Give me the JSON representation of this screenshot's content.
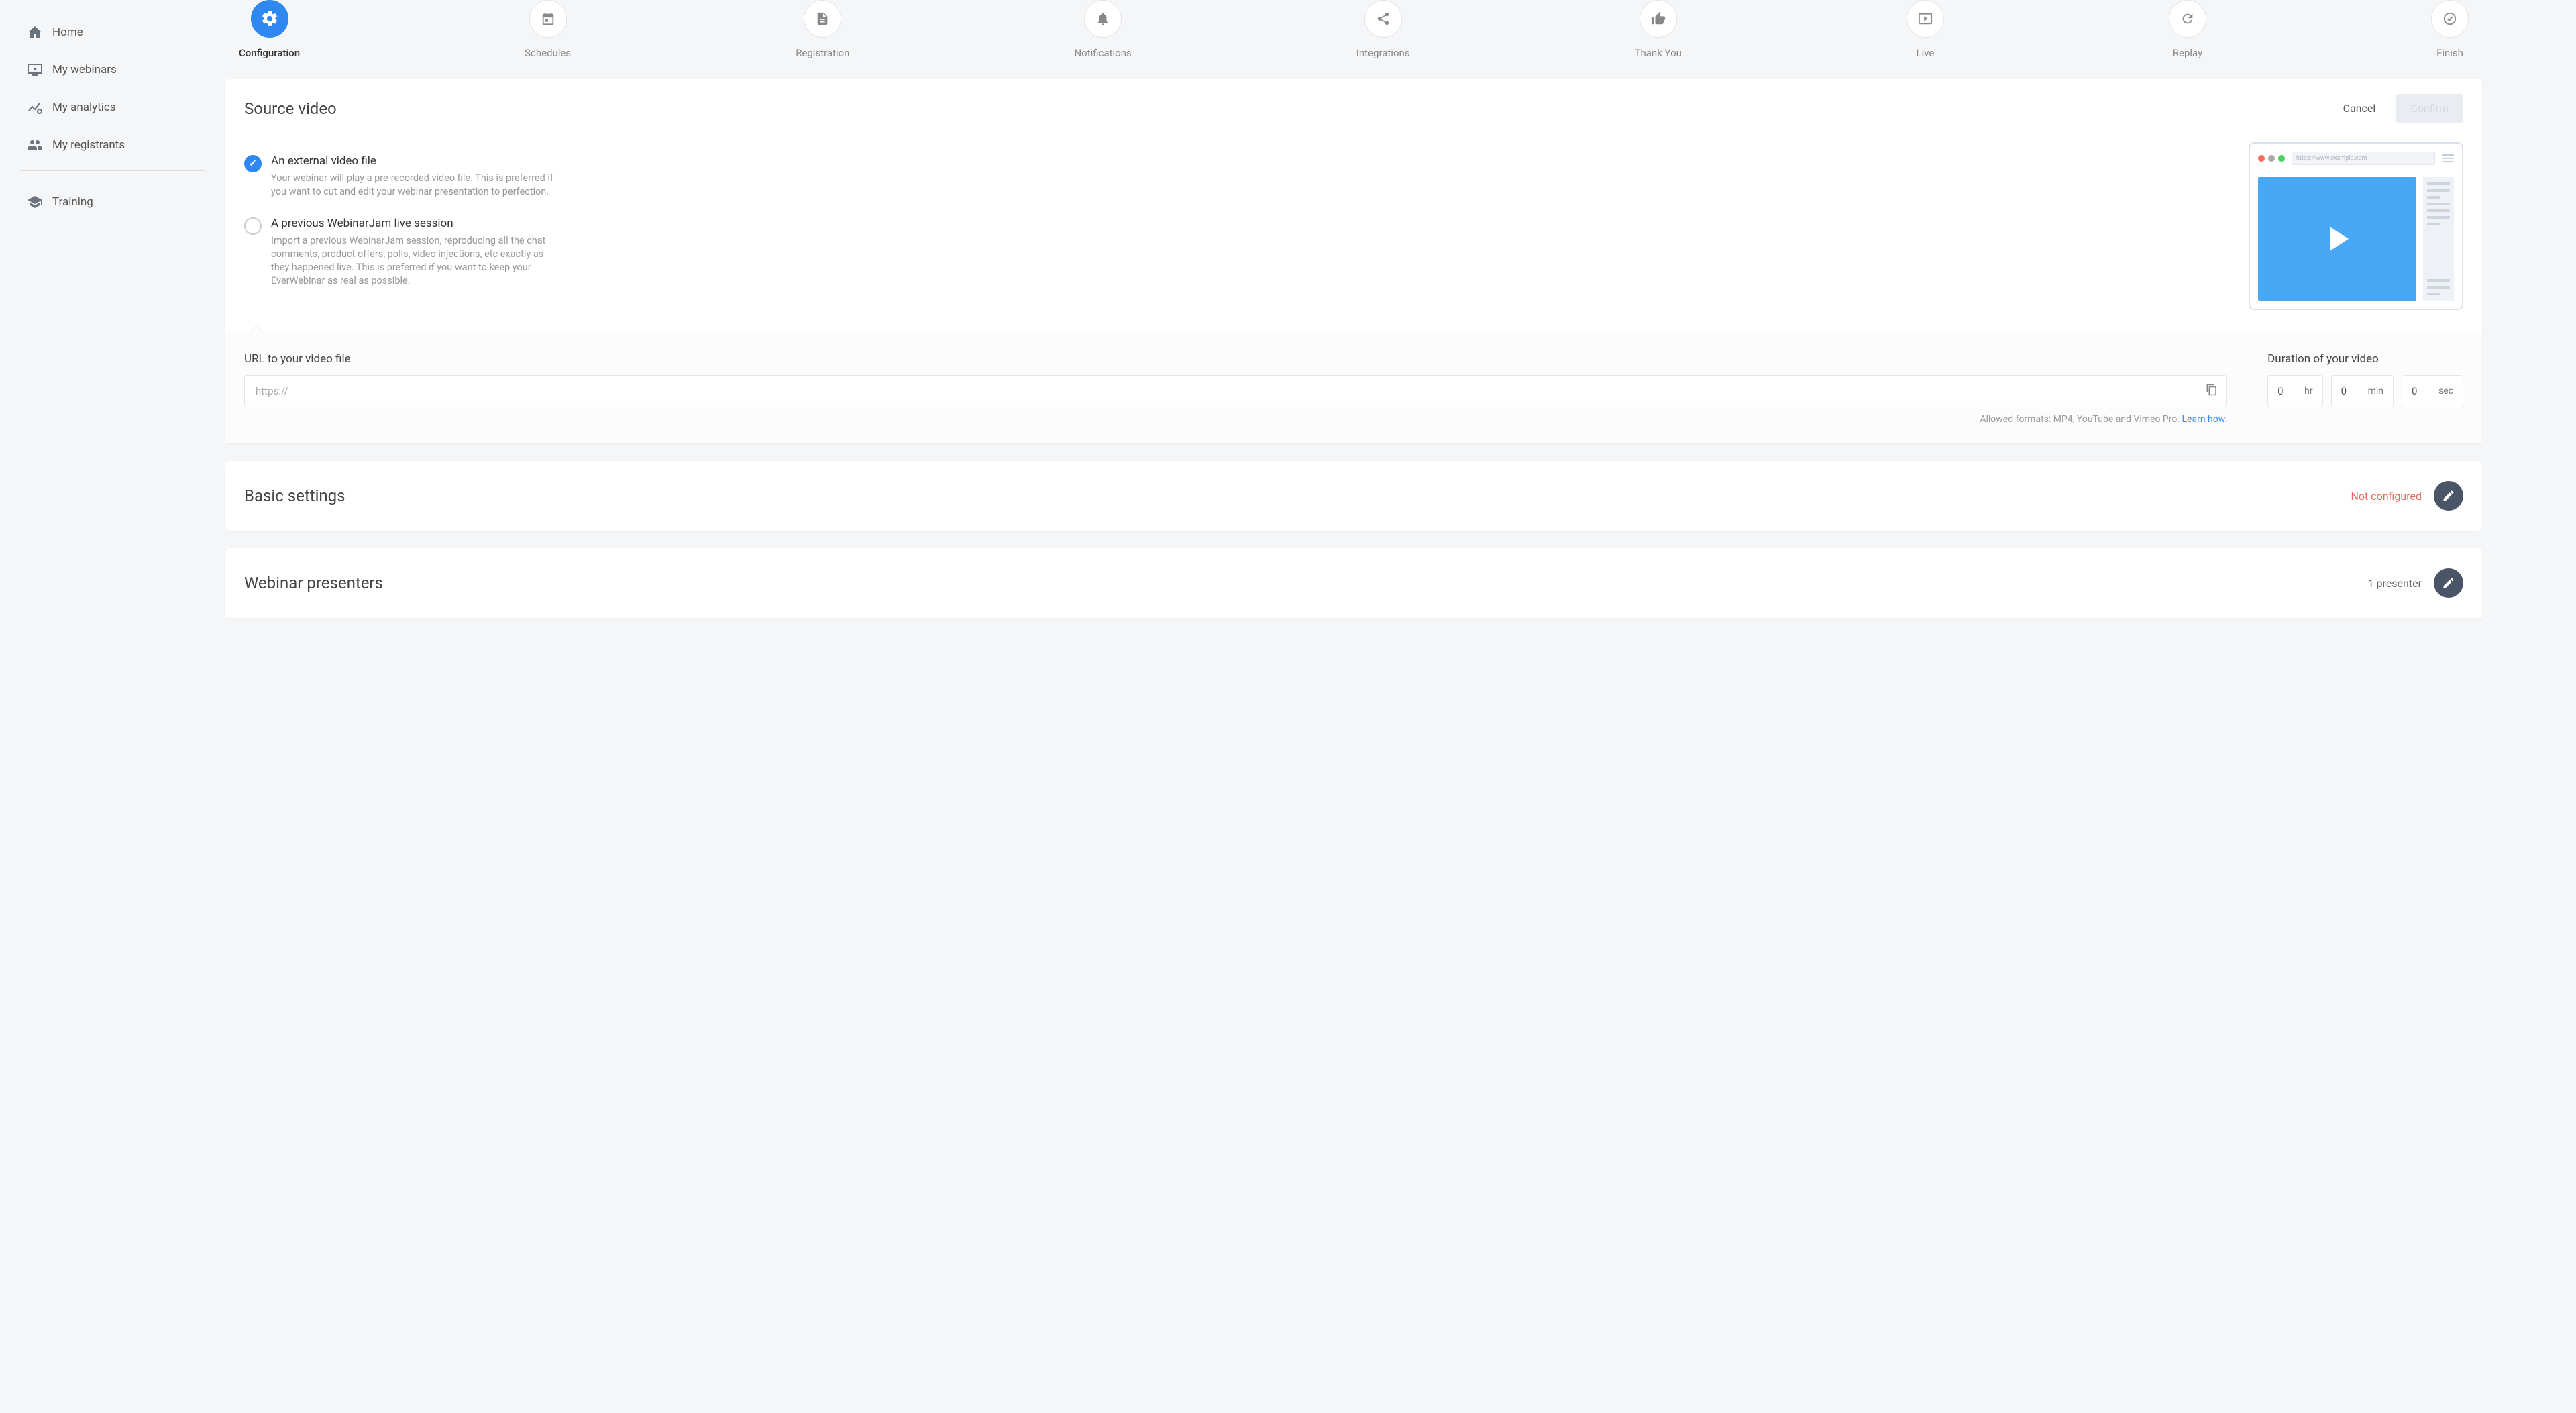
{
  "sidebar": {
    "items": [
      {
        "label": "Home",
        "icon": "home"
      },
      {
        "label": "My webinars",
        "icon": "monitor"
      },
      {
        "label": "My analytics",
        "icon": "chart"
      },
      {
        "label": "My registrants",
        "icon": "people"
      },
      {
        "label": "Training",
        "icon": "grad"
      }
    ]
  },
  "steps": [
    {
      "label": "Configuration",
      "icon": "gear",
      "active": true
    },
    {
      "label": "Schedules",
      "icon": "calday"
    },
    {
      "label": "Registration",
      "icon": "doc"
    },
    {
      "label": "Notifications",
      "icon": "bell"
    },
    {
      "label": "Integrations",
      "icon": "share"
    },
    {
      "label": "Thank You",
      "icon": "thumb"
    },
    {
      "label": "Live",
      "icon": "play"
    },
    {
      "label": "Replay",
      "icon": "refresh"
    },
    {
      "label": "Finish",
      "icon": "check"
    }
  ],
  "source_video": {
    "title": "Source video",
    "cancel": "Cancel",
    "confirm": "Confirm",
    "options": [
      {
        "title": "An external video file",
        "desc": "Your webinar will play a pre-recorded video file. This is preferred if you want to cut and edit your webinar presentation to perfection.",
        "selected": true
      },
      {
        "title": "A previous WebinarJam live session",
        "desc": "Import a previous WebinarJam session, reproducing all the chat comments, product offers, polls, video injections, etc exactly as they happened live. This is preferred if you want to keep your EverWebinar as real as possible.",
        "selected": false
      }
    ],
    "preview_url": "https://www.example.com",
    "url_label": "URL to your video file",
    "url_placeholder": "https://",
    "url_value": "",
    "hint_text": "Allowed formats: MP4, YouTube and Vimeo Pro. ",
    "hint_link": "Learn how",
    "hint_dot": ".",
    "duration_label": "Duration of your video",
    "duration": {
      "hr": {
        "value": "0",
        "label": "hr"
      },
      "min": {
        "value": "0",
        "label": "min"
      },
      "sec": {
        "value": "0",
        "label": "sec"
      }
    }
  },
  "basic_settings": {
    "title": "Basic settings",
    "status": "Not configured"
  },
  "presenters": {
    "title": "Webinar presenters",
    "status": "1 presenter"
  }
}
